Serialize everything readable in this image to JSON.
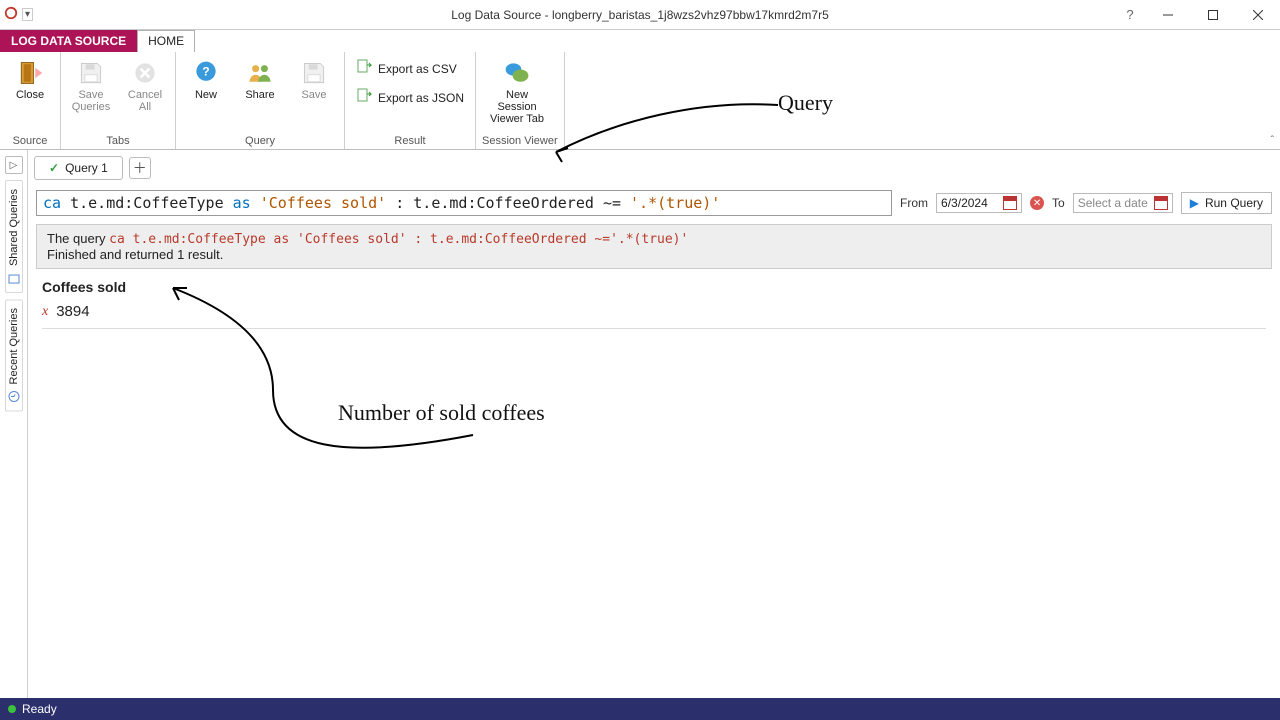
{
  "window": {
    "title": "Log Data Source - longberry_baristas_1j8wzs2vhz97bbw17kmrd2m7r5"
  },
  "context_tabs": {
    "active": "LOG DATA SOURCE",
    "other": "HOME"
  },
  "ribbon": {
    "source": {
      "group": "Source",
      "close": "Close"
    },
    "tabs": {
      "group": "Tabs",
      "save_queries": "Save\nQueries",
      "cancel_all": "Cancel\nAll"
    },
    "query": {
      "group": "Query",
      "new": "New",
      "share": "Share",
      "save": "Save"
    },
    "result": {
      "group": "Result",
      "csv": "Export as CSV",
      "json": "Export as JSON"
    },
    "session": {
      "group": "Session Viewer",
      "new_session": "New Session\nViewer Tab"
    }
  },
  "sidebar": {
    "shared": "Shared Queries",
    "recent": "Recent Queries"
  },
  "tabs": {
    "q1": "Query 1"
  },
  "query": {
    "tokens": {
      "ca": "ca",
      "p1": "t.e.md:CoffeeType",
      "as": "as",
      "alias": "'Coffees sold'",
      "colon": " : ",
      "p2": "t.e.md:CoffeeOrdered",
      "op": " ~=",
      "rhs": "'.*(true)'"
    },
    "plain": "ca t.e.md:CoffeeType as 'Coffees sold' : t.e.md:CoffeeOrdered ~='.*(true)'",
    "from_label": "From",
    "from_value": "6/3/2024",
    "to_label": "To",
    "to_placeholder": "Select a date",
    "run": "Run Query"
  },
  "status": {
    "prefix": "The query ",
    "suffix": "Finished and returned 1 result."
  },
  "result": {
    "column": "Coffees sold",
    "value": "3894"
  },
  "statusbar": {
    "ready": "Ready"
  },
  "annotations": {
    "query": "Query",
    "count": "Number of sold coffees"
  }
}
